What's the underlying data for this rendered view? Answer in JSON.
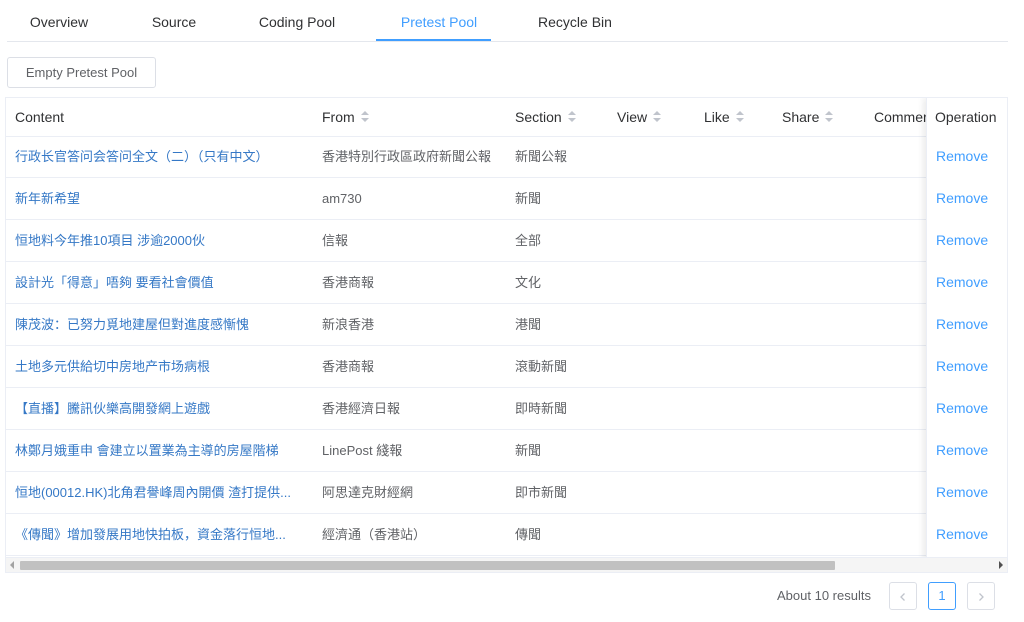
{
  "tabs": [
    {
      "label": "Overview",
      "active": false
    },
    {
      "label": "Source",
      "active": false
    },
    {
      "label": "Coding Pool",
      "active": false
    },
    {
      "label": "Pretest Pool",
      "active": true
    },
    {
      "label": "Recycle Bin",
      "active": false
    }
  ],
  "toolbar": {
    "empty_label": "Empty Pretest Pool"
  },
  "table": {
    "columns": [
      "Content",
      "From",
      "Section",
      "View",
      "Like",
      "Share",
      "Commer"
    ],
    "operation_header": "Operation",
    "remove_label": "Remove",
    "rows": [
      {
        "content": "行政长官答问会答问全文（二）（只有中文）",
        "from": "香港特別行政區政府新聞公報",
        "section": "新聞公報"
      },
      {
        "content": "新年新希望",
        "from": "am730",
        "section": "新聞"
      },
      {
        "content": "恒地料今年推10項目 涉逾2000伙",
        "from": "信報",
        "section": "全部"
      },
      {
        "content": "設計光「得意」唔夠 要看社會價值",
        "from": "香港商報",
        "section": "文化"
      },
      {
        "content": "陳茂波：已努力覓地建屋但對進度感慚愧",
        "from": "新浪香港",
        "section": "港聞"
      },
      {
        "content": "土地多元供給切中房地产市场病根",
        "from": "香港商報",
        "section": "滾動新聞"
      },
      {
        "content": "【直播】騰訊伙樂高開發網上遊戲",
        "from": "香港經濟日報",
        "section": "即時新聞"
      },
      {
        "content": "林鄭月娥重申 會建立以置業為主導的房屋階梯",
        "from": "LinePost 綫報",
        "section": "新聞"
      },
      {
        "content": "恒地(00012.HK)北角君譽峰周內開價 渣打提供...",
        "from": "阿思達克財經網",
        "section": "即市新聞"
      },
      {
        "content": "《傳聞》增加發展用地快拍板，資金落行恒地...",
        "from": "經濟通（香港站）",
        "section": "傳聞"
      }
    ]
  },
  "pagination": {
    "total_label": "About 10 results",
    "current_page": "1",
    "prev_icon": "chevron-left-icon",
    "next_icon": "chevron-right-icon"
  },
  "colors": {
    "accent": "#409eff",
    "link": "#3578c6",
    "border": "#ebeef5"
  }
}
